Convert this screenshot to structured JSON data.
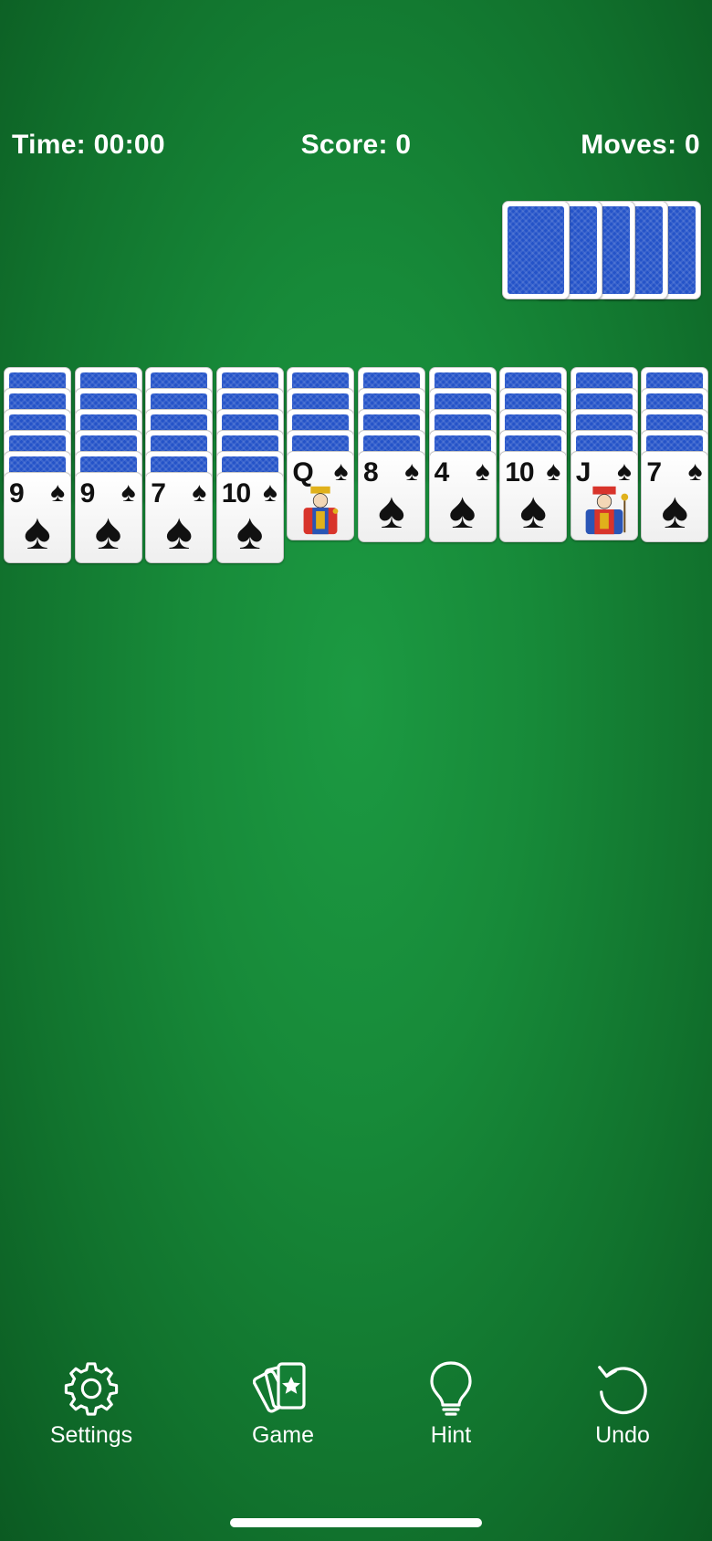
{
  "status": {
    "time": "Time: 00:00",
    "score": "Score: 0",
    "moves": "Moves: 0"
  },
  "stock": {
    "count": 5
  },
  "tableau": {
    "columns": [
      {
        "hidden": 5,
        "top": {
          "rank": "9",
          "suit": "♠",
          "court": false
        }
      },
      {
        "hidden": 5,
        "top": {
          "rank": "9",
          "suit": "♠",
          "court": false
        }
      },
      {
        "hidden": 5,
        "top": {
          "rank": "7",
          "suit": "♠",
          "court": false
        }
      },
      {
        "hidden": 5,
        "top": {
          "rank": "10",
          "suit": "♠",
          "court": false
        }
      },
      {
        "hidden": 4,
        "top": {
          "rank": "Q",
          "suit": "♠",
          "court": true
        }
      },
      {
        "hidden": 4,
        "top": {
          "rank": "8",
          "suit": "♠",
          "court": false
        }
      },
      {
        "hidden": 4,
        "top": {
          "rank": "4",
          "suit": "♠",
          "court": false
        }
      },
      {
        "hidden": 4,
        "top": {
          "rank": "10",
          "suit": "♠",
          "court": false
        }
      },
      {
        "hidden": 4,
        "top": {
          "rank": "J",
          "suit": "♠",
          "court": true
        }
      },
      {
        "hidden": 4,
        "top": {
          "rank": "7",
          "suit": "♠",
          "court": false
        }
      }
    ]
  },
  "toolbar": {
    "settings_label": "Settings",
    "game_label": "Game",
    "hint_label": "Hint",
    "undo_label": "Undo"
  },
  "icons": {
    "settings": "gear-icon",
    "game": "cards-icon",
    "hint": "lightbulb-icon",
    "undo": "undo-icon"
  },
  "colors": {
    "felt": "#178a39",
    "card_back": "#2453c8",
    "text": "#ffffff"
  }
}
